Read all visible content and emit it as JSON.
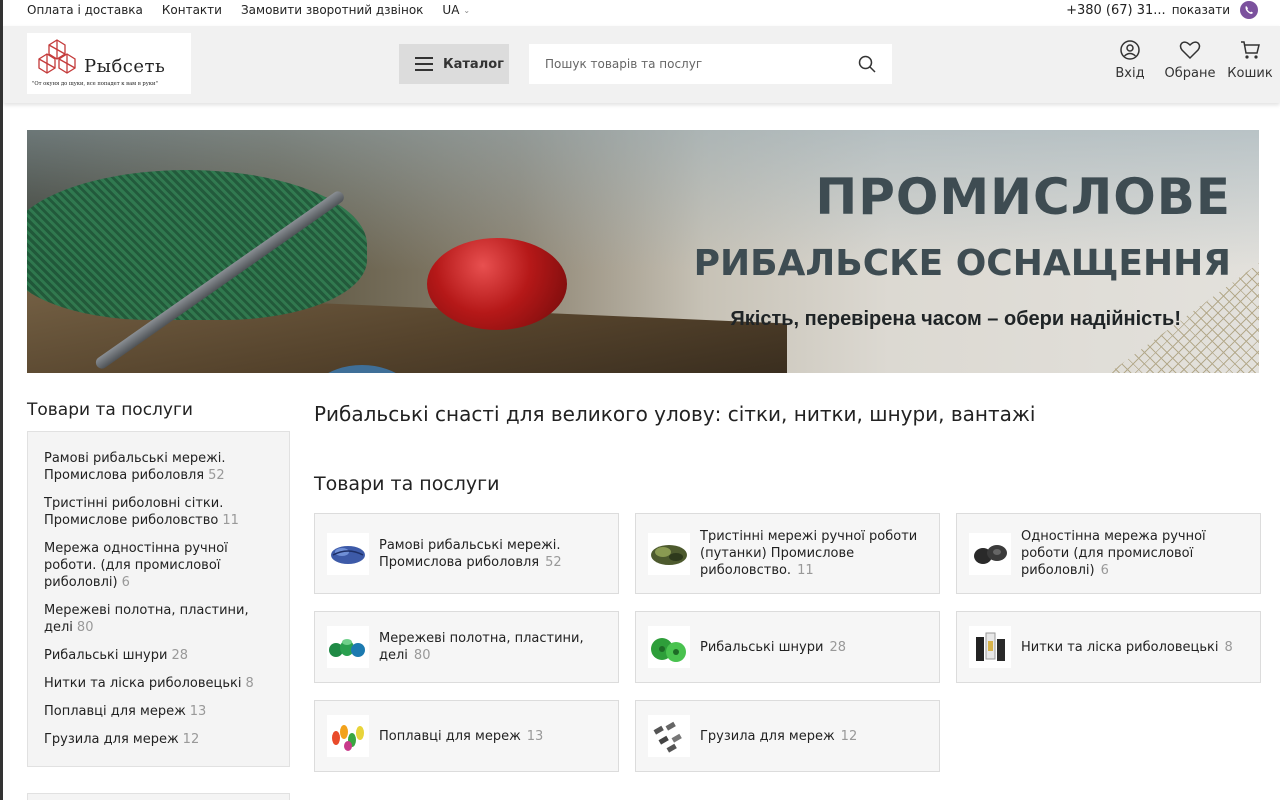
{
  "topbar": {
    "links": [
      "Оплата і доставка",
      "Контакти",
      "Замовити зворотний дзвінок"
    ],
    "lang": "UA",
    "phone": "+380 (67) 31...",
    "show_label": "показати"
  },
  "header": {
    "logo_brand": "Рыбсеть",
    "logo_slogan": "\"От окуня до щуки, все попадет к вам в руки\"",
    "catalog_label": "Каталог",
    "search_placeholder": "Пошук товарів та послуг",
    "login_label": "Вхід",
    "favorites_label": "Обране",
    "cart_label": "Кошик"
  },
  "banner": {
    "line1": "ПРОМИСЛОВЕ",
    "line2": "РИБАЛЬСКЕ ОСНАЩЕННЯ",
    "line3": "Якість, перевірена часом – обери надійність!"
  },
  "sidebar": {
    "title": "Товари та послуги",
    "items": [
      {
        "label": "Рамові рибальські мережі. Промислова риболовля",
        "count": "52"
      },
      {
        "label": "Тристінні риболовні сітки. Промислове риболовство",
        "count": "11"
      },
      {
        "label": "Мережа одностінна ручної роботи. (для промислової риболовлі)",
        "count": "6"
      },
      {
        "label": "Мережеві полотна, пластини, делі",
        "count": "80"
      },
      {
        "label": "Рибальські шнури",
        "count": "28"
      },
      {
        "label": "Нитки та ліска риболовецькі",
        "count": "8"
      },
      {
        "label": "Поплавці для мереж",
        "count": "13"
      },
      {
        "label": "Грузила для мереж",
        "count": "12"
      }
    ]
  },
  "main": {
    "heading": "Рибальські снасті для великого улову: сітки, нитки, шнури, вантажі",
    "section_title": "Товари та послуги",
    "cards": [
      {
        "label": "Рамові рибальські мережі. Промислова риболовля",
        "count": "52",
        "icon": "net-blue-icon"
      },
      {
        "label": "Тристінні мережі ручної роботи (путанки) Промислове риболовство.",
        "count": "11",
        "icon": "net-green-icon"
      },
      {
        "label": "Одностінна мережа ручної роботи (для промислової риболовлі)",
        "count": "6",
        "icon": "net-dark-icon"
      },
      {
        "label": "Мережеві полотна, пластини, делі",
        "count": "80",
        "icon": "net-sheets-icon"
      },
      {
        "label": "Рибальські шнури",
        "count": "28",
        "icon": "cord-icon"
      },
      {
        "label": "Нитки та ліска риболовецькі",
        "count": "8",
        "icon": "thread-icon"
      },
      {
        "label": "Поплавці для мереж",
        "count": "13",
        "icon": "float-icon"
      },
      {
        "label": "Грузила для мереж",
        "count": "12",
        "icon": "sinker-icon"
      }
    ]
  },
  "colors": {
    "header_bg": "#f1f1f1",
    "catalog_btn": "#dcdcdc",
    "banner_text": "#3e4c52",
    "viber": "#7b519d",
    "count_gray": "#999999"
  }
}
